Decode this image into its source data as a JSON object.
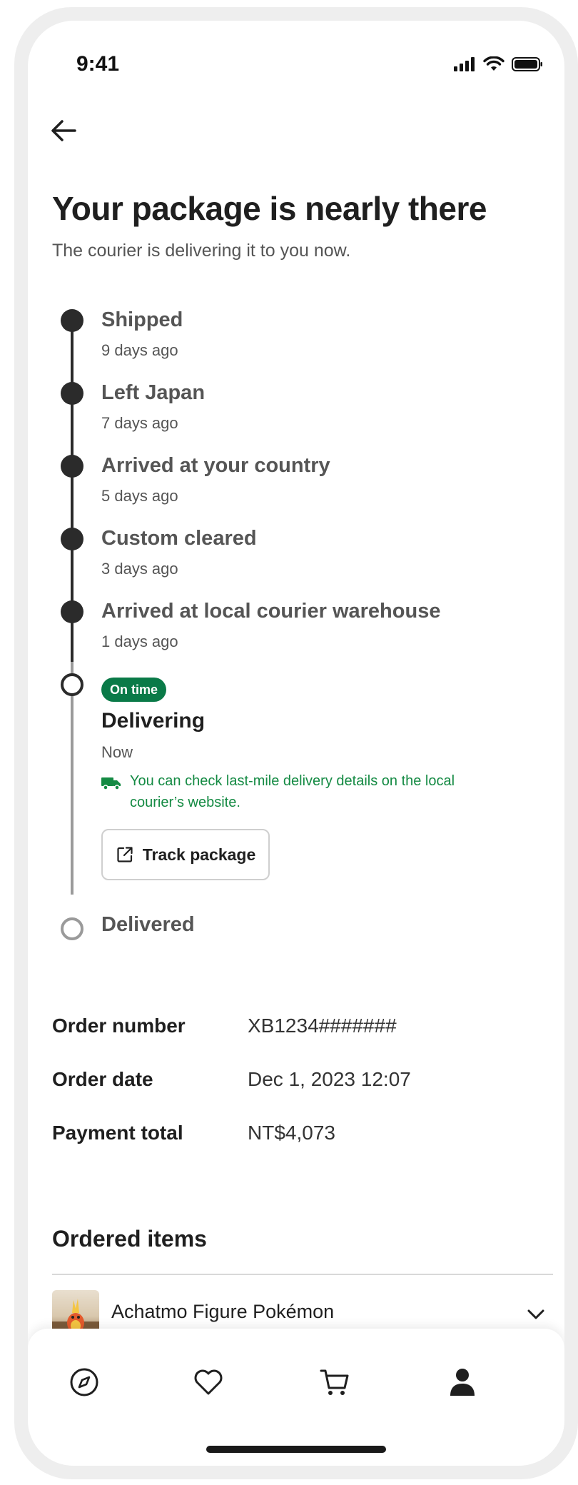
{
  "status_bar": {
    "time": "9:41"
  },
  "header": {
    "title": "Your package is nearly there",
    "subtitle": "The courier is delivering it to you now."
  },
  "timeline": {
    "steps": [
      {
        "label": "Shipped",
        "time": "9 days ago"
      },
      {
        "label": "Left Japan",
        "time": "7 days ago"
      },
      {
        "label": "Arrived at your country",
        "time": "5 days ago"
      },
      {
        "label": "Custom cleared",
        "time": "3 days ago"
      },
      {
        "label": "Arrived at local courier warehouse",
        "time": "1 days ago"
      }
    ],
    "current": {
      "badge": "On time",
      "label": "Delivering",
      "time": "Now",
      "info": "You can check last-mile delivery details on the local courier’s website.",
      "button_label": "Track package"
    },
    "final": {
      "label": "Delivered"
    }
  },
  "order_details": [
    {
      "label": "Order number",
      "value": "XB1234#######"
    },
    {
      "label": "Order date",
      "value": "Dec 1, 2023 12:07"
    },
    {
      "label": "Payment total",
      "value": "NT$4,073"
    }
  ],
  "ordered_items": {
    "title": "Ordered items",
    "items": [
      {
        "name": "Achatmo Figure Pokémon"
      }
    ]
  },
  "tab_bar": {
    "tabs": [
      {
        "icon": "compass-icon"
      },
      {
        "icon": "heart-icon"
      },
      {
        "icon": "cart-icon"
      },
      {
        "icon": "profile-icon"
      }
    ]
  },
  "colors": {
    "badge_green": "#0a7a48",
    "info_green": "#148a43",
    "text_dark": "#1f1f1f",
    "text_muted": "#555555"
  }
}
